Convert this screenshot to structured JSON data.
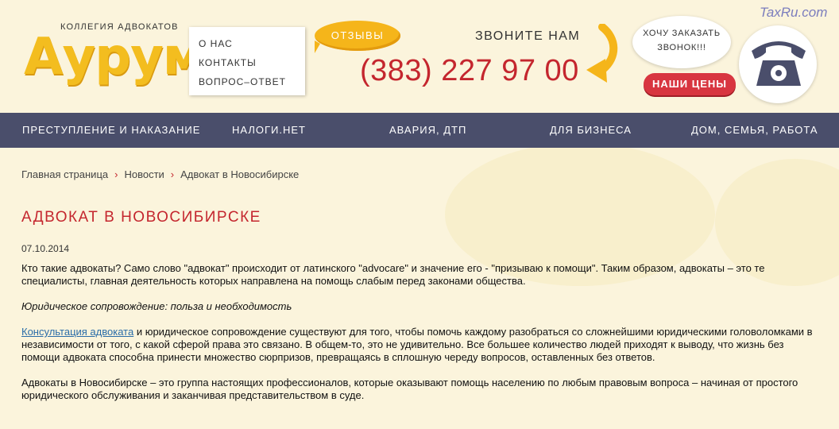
{
  "header": {
    "tagline": "КОЛЛЕГИЯ АДВОКАТОВ",
    "logo_text": "Аурум",
    "nav_box": [
      "О НАС",
      "КОНТАКТЫ",
      "ВОПРОС–ОТВЕТ"
    ],
    "reviews_label": "ОТЗЫВЫ",
    "call_us": "ЗВОНИТЕ НАМ",
    "phone": "(383) 227 97 00",
    "callback_line1": "ХОЧУ ЗАКАЗАТЬ",
    "callback_line2": "ЗВОНОК!!!",
    "prices_label": "НАШИ ЦЕНЫ",
    "watermark": "TaxRu.com"
  },
  "main_nav": [
    "ПРЕСТУПЛЕНИЕ И НАКАЗАНИЕ",
    "НАЛОГИ.НЕТ",
    "АВАРИЯ, ДТП",
    "ДЛЯ БИЗНЕСА",
    "ДОМ, СЕМЬЯ, РАБОТА"
  ],
  "breadcrumb": [
    "Главная страница",
    "Новости",
    "Адвокат в Новосибирске"
  ],
  "article": {
    "title": "АДВОКАТ В НОВОСИБИРСКЕ",
    "date": "07.10.2014",
    "p1": "Кто такие адвокаты? Само слово \"адвокат\" происходит от латинского \"advocare\" и значение его - \"призываю к помощи\". Таким образом, адвокаты – это те специалисты, главная деятельность которых направлена на помощь слабым перед законами общества.",
    "subhead": "Юридическое сопровождение: польза и необходимость",
    "p3_link": "Консультация адвоката",
    "p3_rest": " и юридическое сопровождение существуют для того, чтобы помочь каждому разобраться со сложнейшими юридическими головоломками в независимости от того, с какой сферой права это связано. В общем-то, это не удивительно. Все большее количество людей приходят к выводу, что жизнь без помощи адвоката способна принести множество сюрпризов, превращаясь в сплошную череду вопросов, оставленных без ответов.",
    "p4": "Адвокаты в Новосибирске – это группа настоящих профессионалов, которые оказывают помощь населению по любым правовым вопроса – начиная от простого юридического обслуживания и заканчивая представительством в суде."
  },
  "colors": {
    "accent_red": "#c4262e",
    "logo_yellow": "#f3bd1f",
    "nav_bg": "#4a4e6b",
    "page_bg": "#fbf4dc"
  },
  "icons": [
    "telephone-icon",
    "curved-arrow-icon"
  ]
}
